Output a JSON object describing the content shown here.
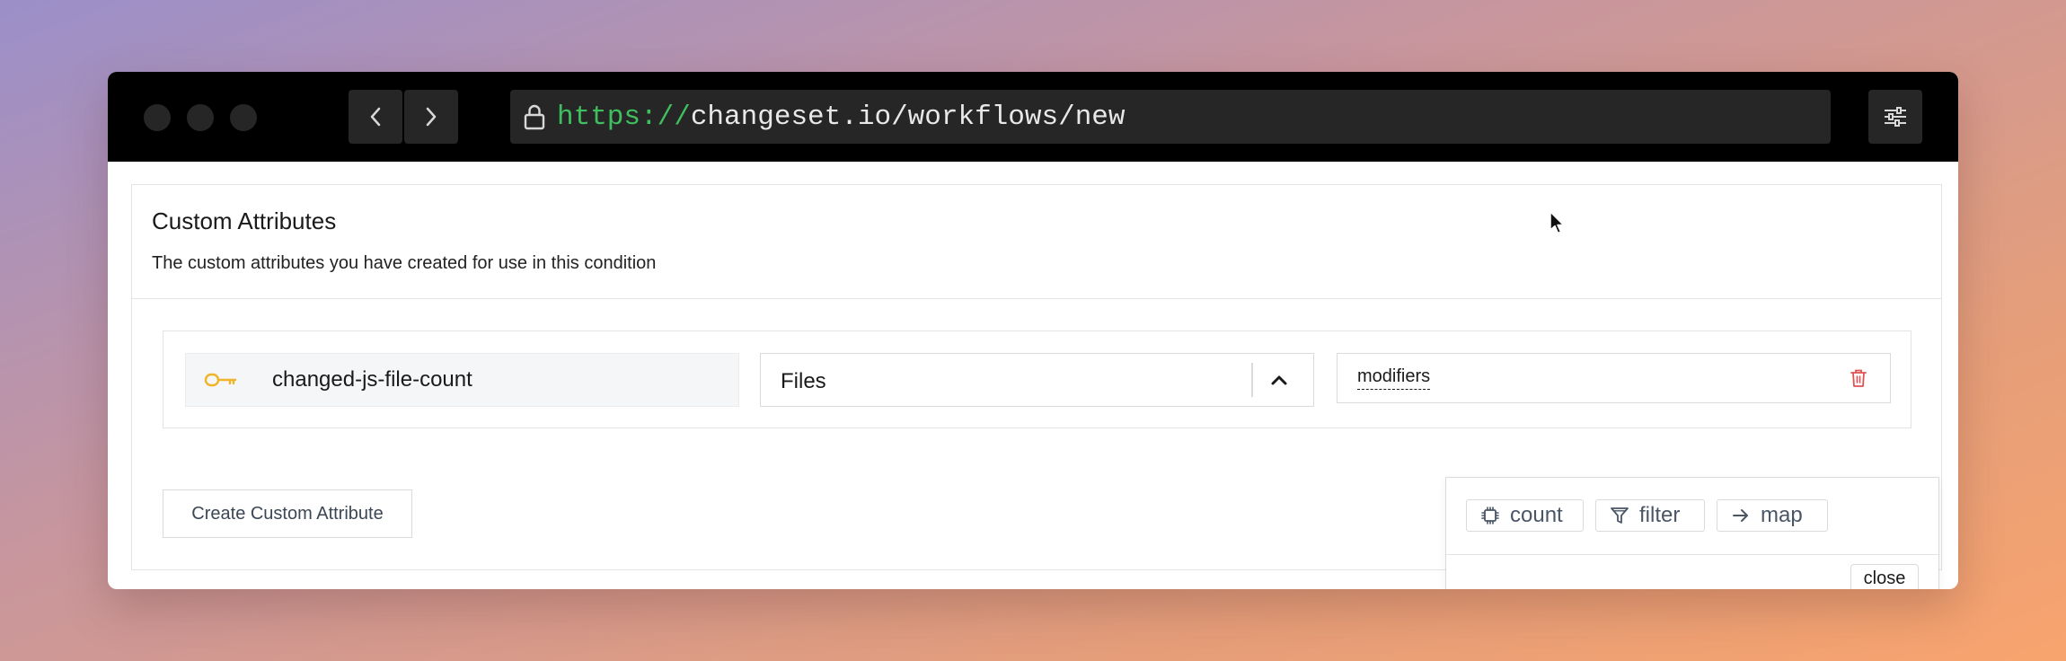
{
  "browser": {
    "url_scheme": "https://",
    "url_rest": "changeset.io/workflows/new",
    "icons": {
      "lock": "lock-icon",
      "back": "chevron-left-icon",
      "forward": "chevron-right-icon",
      "settings": "sliders-icon"
    }
  },
  "panel": {
    "title": "Custom Attributes",
    "description": "The custom attributes you have created for use in this condition"
  },
  "attribute": {
    "name": "changed-js-file-count",
    "type_value": "Files",
    "modifiers_label": "modifiers",
    "icons": {
      "name": "key-icon",
      "type_toggle": "chevron-up-icon",
      "delete": "trash-icon"
    }
  },
  "popover": {
    "options": [
      {
        "label": "count",
        "icon": "chip-icon"
      },
      {
        "label": "filter",
        "icon": "funnel-icon"
      },
      {
        "label": "map",
        "icon": "arrow-right-icon"
      }
    ],
    "close_label": "close"
  },
  "actions": {
    "create_label": "Create Custom Attribute"
  },
  "colors": {
    "url_scheme": "#3fbf5f",
    "key_icon": "#f0b429",
    "delete_icon": "#e05252",
    "titlebar": "#000000",
    "control_bg": "#262626"
  }
}
